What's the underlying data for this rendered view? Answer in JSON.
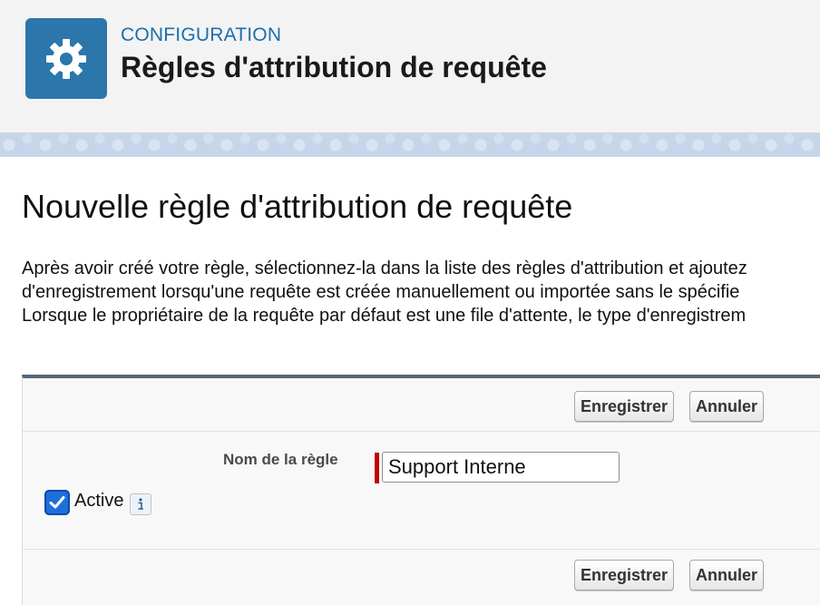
{
  "header": {
    "icon": "gear-icon",
    "eyebrow": "CONFIGURATION",
    "title": "Règles d'attribution de requête"
  },
  "page": {
    "heading": "Nouvelle règle d'attribution de requête",
    "intro_lines": [
      "Après avoir créé votre règle, sélectionnez-la dans la liste des règles d'attribution et ajoutez",
      "d'enregistrement lorsqu'une requête est créée manuellement ou importée sans le spécifie",
      "Lorsque le propriétaire de la requête par défaut est une file d'attente, le type d'enregistrem"
    ]
  },
  "form": {
    "save_label": "Enregistrer",
    "cancel_label": "Annuler",
    "rule_name_label": "Nom de la règle",
    "rule_name_value": "Support Interne",
    "active_label": "Active",
    "active_checked": true,
    "info_icon": "info-icon"
  },
  "colors": {
    "header_icon_bg": "#2b77ab",
    "eyebrow": "#1b6fb0",
    "required": "#c00000",
    "checkbox": "#1e6fdc"
  }
}
